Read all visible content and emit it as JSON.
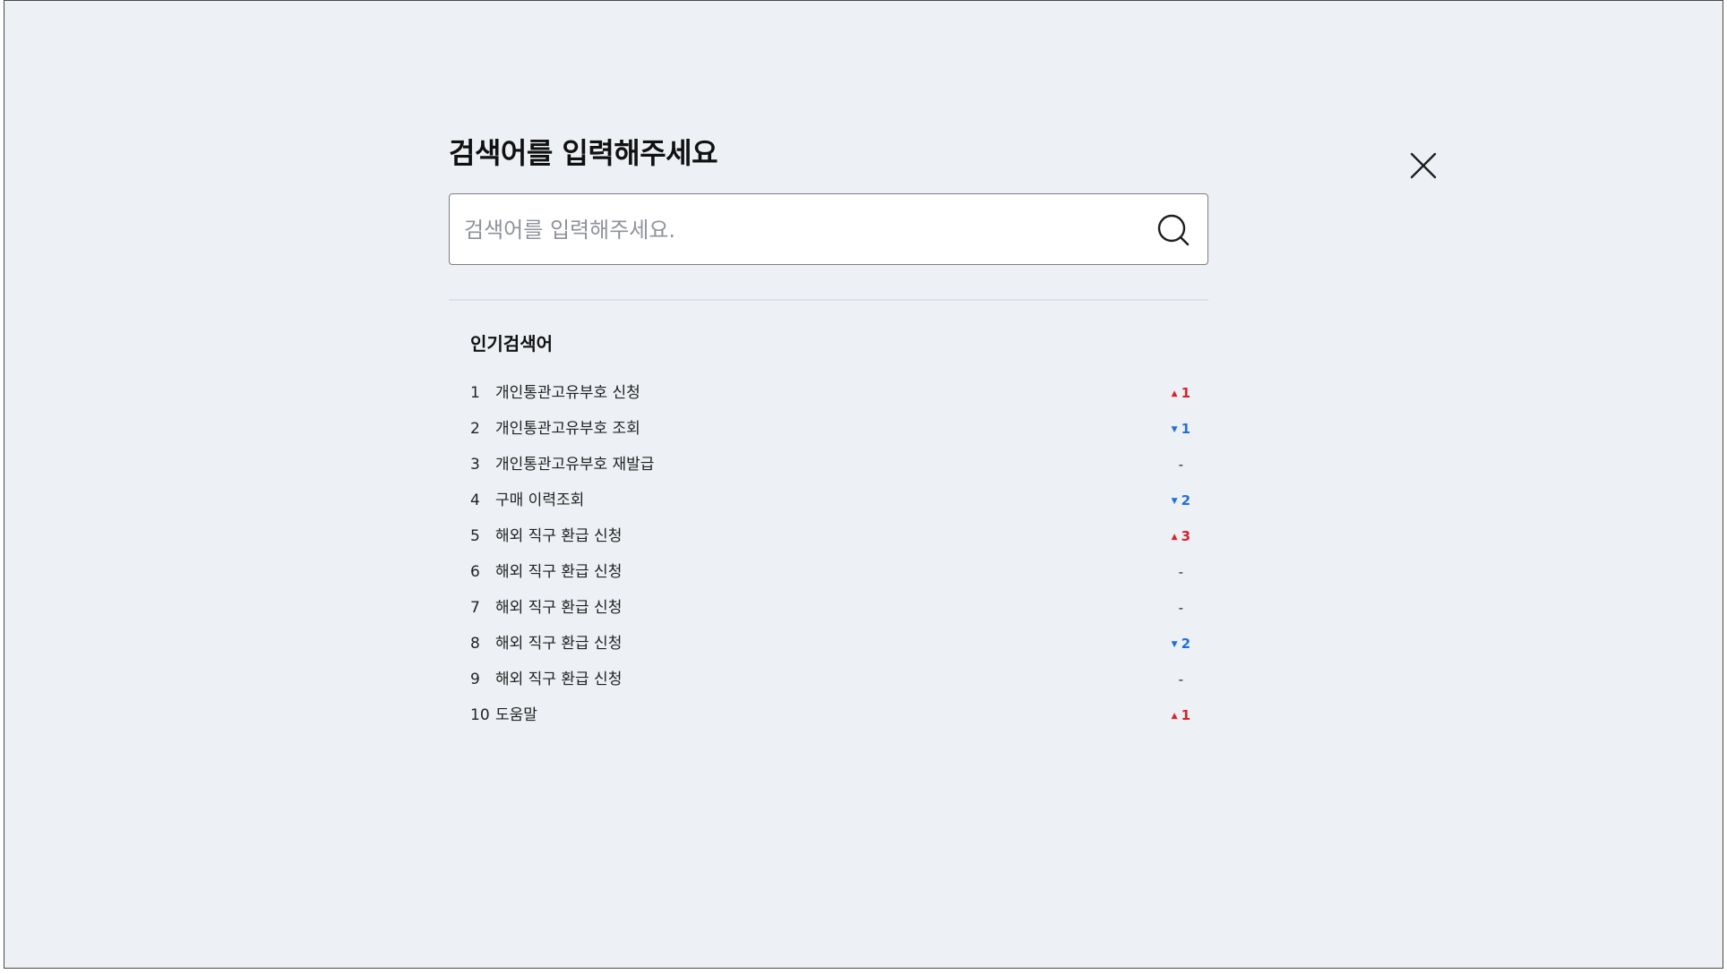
{
  "modal": {
    "title": "검색어를 입력해주세요",
    "search_placeholder": "검색어를 입력해주세요.",
    "search_value": ""
  },
  "popular": {
    "heading": "인기검색어",
    "items": [
      {
        "rank": "1",
        "term": "개인통관고유부호 신청",
        "trend": "up",
        "change": "1"
      },
      {
        "rank": "2",
        "term": "개인통관고유부호 조회",
        "trend": "down",
        "change": "1"
      },
      {
        "rank": "3",
        "term": "개인통관고유부호 재발급",
        "trend": "same",
        "change": "-"
      },
      {
        "rank": "4",
        "term": "구매 이력조회",
        "trend": "down",
        "change": "2"
      },
      {
        "rank": "5",
        "term": "해외 직구 환급 신청",
        "trend": "up",
        "change": "3"
      },
      {
        "rank": "6",
        "term": "해외 직구 환급 신청",
        "trend": "same",
        "change": "-"
      },
      {
        "rank": "7",
        "term": "해외 직구 환급 신청",
        "trend": "same",
        "change": "-"
      },
      {
        "rank": "8",
        "term": "해외 직구 환급 신청",
        "trend": "down",
        "change": "2"
      },
      {
        "rank": "9",
        "term": "해외 직구 환급 신청",
        "trend": "same",
        "change": "-"
      },
      {
        "rank": "10",
        "term": "도움말",
        "trend": "up",
        "change": "1"
      }
    ]
  },
  "icons": {
    "close": "close-icon",
    "search": "search-icon",
    "up": "arrow-up-icon",
    "down": "arrow-down-icon"
  },
  "colors": {
    "background": "#edf0f4",
    "up": "#d9222a",
    "down": "#1f6fe0",
    "text": "#111111"
  }
}
